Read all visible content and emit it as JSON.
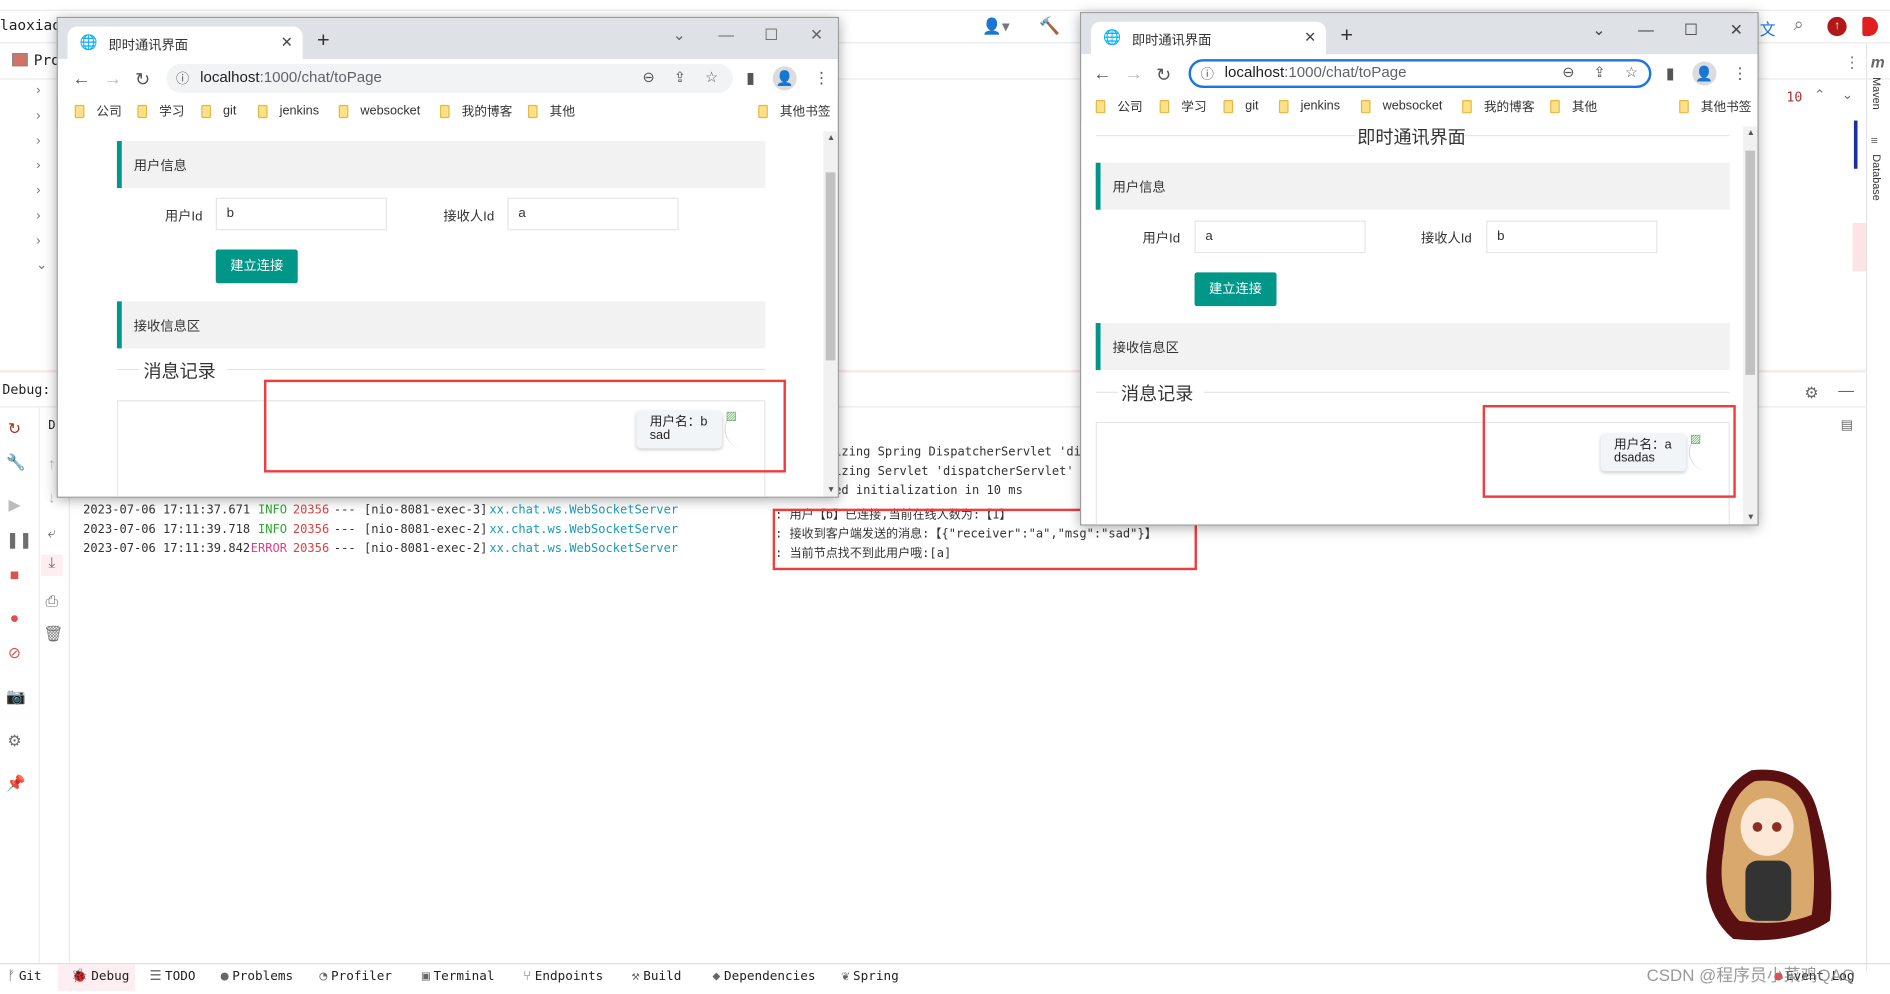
{
  "ide": {
    "project_title": "laoxiao-",
    "project_tab": "Pro",
    "debug_label": "Debug:",
    "debug_tab_short": "D",
    "line_number": "10",
    "right_tools": [
      "Maven",
      "Database"
    ],
    "console": [
      {
        "time": "2023-07-06 17:11:37.671",
        "level": "INFO",
        "pid": "20356",
        "sep": "---",
        "thread": "[nio-8081-exec-3]",
        "logger": "xx.chat.ws.WebSocketServer",
        "msg": ": 用户【b】已连接,当前在线人数为:【1】"
      },
      {
        "time": "2023-07-06 17:11:39.718",
        "level": "INFO",
        "pid": "20356",
        "sep": "---",
        "thread": "[nio-8081-exec-2]",
        "logger": "xx.chat.ws.WebSocketServer",
        "msg": ": 接收到客户端发送的消息:【{\"receiver\":\"a\",\"msg\":\"sad\"}】"
      },
      {
        "time": "2023-07-06 17:11:39.842",
        "level": "ERROR",
        "pid": "20356",
        "sep": "---",
        "thread": "[nio-8081-exec-2]",
        "logger": "xx.chat.ws.WebSocketServer",
        "msg": ": 当前节点找不到此用户哦:[a]"
      }
    ],
    "console_partial": [
      "izing Spring DispatcherServlet 'di",
      "izing Servlet 'dispatcherServlet'",
      "ed initialization in 10 ms"
    ],
    "bottom_tabs": [
      "Git",
      "Debug",
      "TODO",
      "Problems",
      "Profiler",
      "Terminal",
      "Endpoints",
      "Build",
      "Dependencies",
      "Spring"
    ],
    "event_log": "Event Log",
    "watermark": "CSDN @程序员小菜鸡QAQ",
    "colors": {
      "info": "#2fa82f",
      "error": "#e0408a",
      "pid": "#e04040",
      "logger": "#1a9bb5",
      "accent": "#009688",
      "highlight": "#f03c3c"
    }
  },
  "browsers": [
    {
      "tab_title": "即时通讯界面",
      "url_host": "localhost",
      "url_path": ":1000/chat/toPage",
      "bookmarks": [
        "公司",
        "学习",
        "git",
        "jenkins",
        "websocket",
        "我的博客",
        "其他"
      ],
      "other_bookmarks": "其他书签",
      "page_title": "即时通讯界面",
      "user_info_header": "用户信息",
      "user_id_label": "用户Id",
      "user_id_value": "b",
      "receiver_label": "接收人Id",
      "receiver_value": "a",
      "connect_button": "建立连接",
      "receive_header": "接收信息区",
      "history_legend": "消息记录",
      "message": {
        "user": "用户名：b",
        "text": "sad"
      }
    },
    {
      "tab_title": "即时通讯界面",
      "url_host": "localhost",
      "url_path": ":1000/chat/toPage",
      "bookmarks": [
        "公司",
        "学习",
        "git",
        "jenkins",
        "websocket",
        "我的博客",
        "其他"
      ],
      "other_bookmarks": "其他书签",
      "page_title": "即时通讯界面",
      "user_info_header": "用户信息",
      "user_id_label": "用户Id",
      "user_id_value": "a",
      "receiver_label": "接收人Id",
      "receiver_value": "b",
      "connect_button": "建立连接",
      "receive_header": "接收信息区",
      "history_legend": "消息记录",
      "message": {
        "user": "用户名：a",
        "text": "dsadas"
      }
    }
  ]
}
